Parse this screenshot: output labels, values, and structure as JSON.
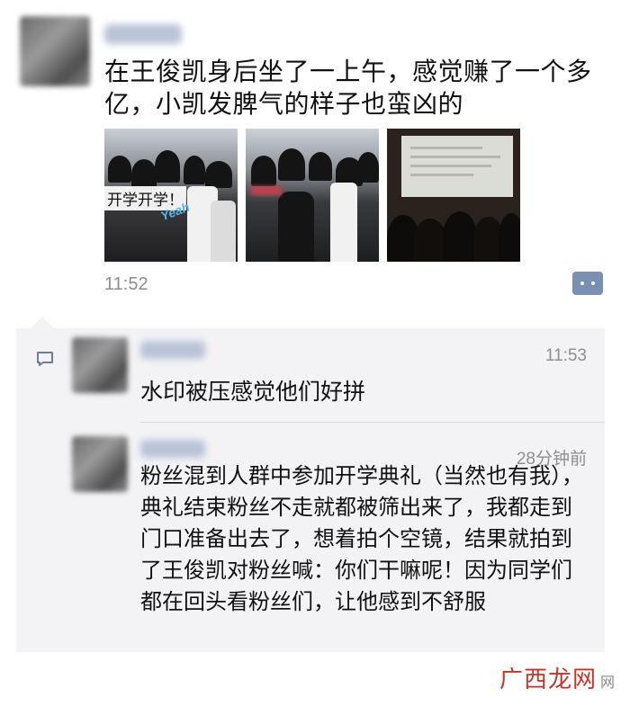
{
  "post": {
    "text": "在王俊凯身后坐了一上午，感觉赚了一个多亿，小凯发脾气的样子也蛮凶的",
    "time": "11:52",
    "photos": [
      {
        "caption": "开学开学！",
        "sticker": "Yeah"
      },
      {},
      {}
    ]
  },
  "comments": [
    {
      "time": "11:53",
      "text": "水印被压感觉他们好拼"
    },
    {
      "time": "28分钟前",
      "text": "粉丝混到人群中参加开学典礼（当然也有我），典礼结束粉丝不走就都被筛出来了，我都走到门口准备出去了，想着拍个空镜，结果就拍到了王俊凯对粉丝喊：你们干嘛呢！因为同学们都在回头看粉丝们，让他感到不舒服"
    }
  ],
  "watermark": {
    "text": "广西龙网",
    "small": "网"
  },
  "colors": {
    "link_name": "#576b95",
    "more_button": "#7b8fb3",
    "comment_bg": "#f3f3f5",
    "watermark": "#c0362b"
  },
  "icons": {
    "more": "more-dots-icon",
    "comment": "comment-bubble-icon"
  }
}
